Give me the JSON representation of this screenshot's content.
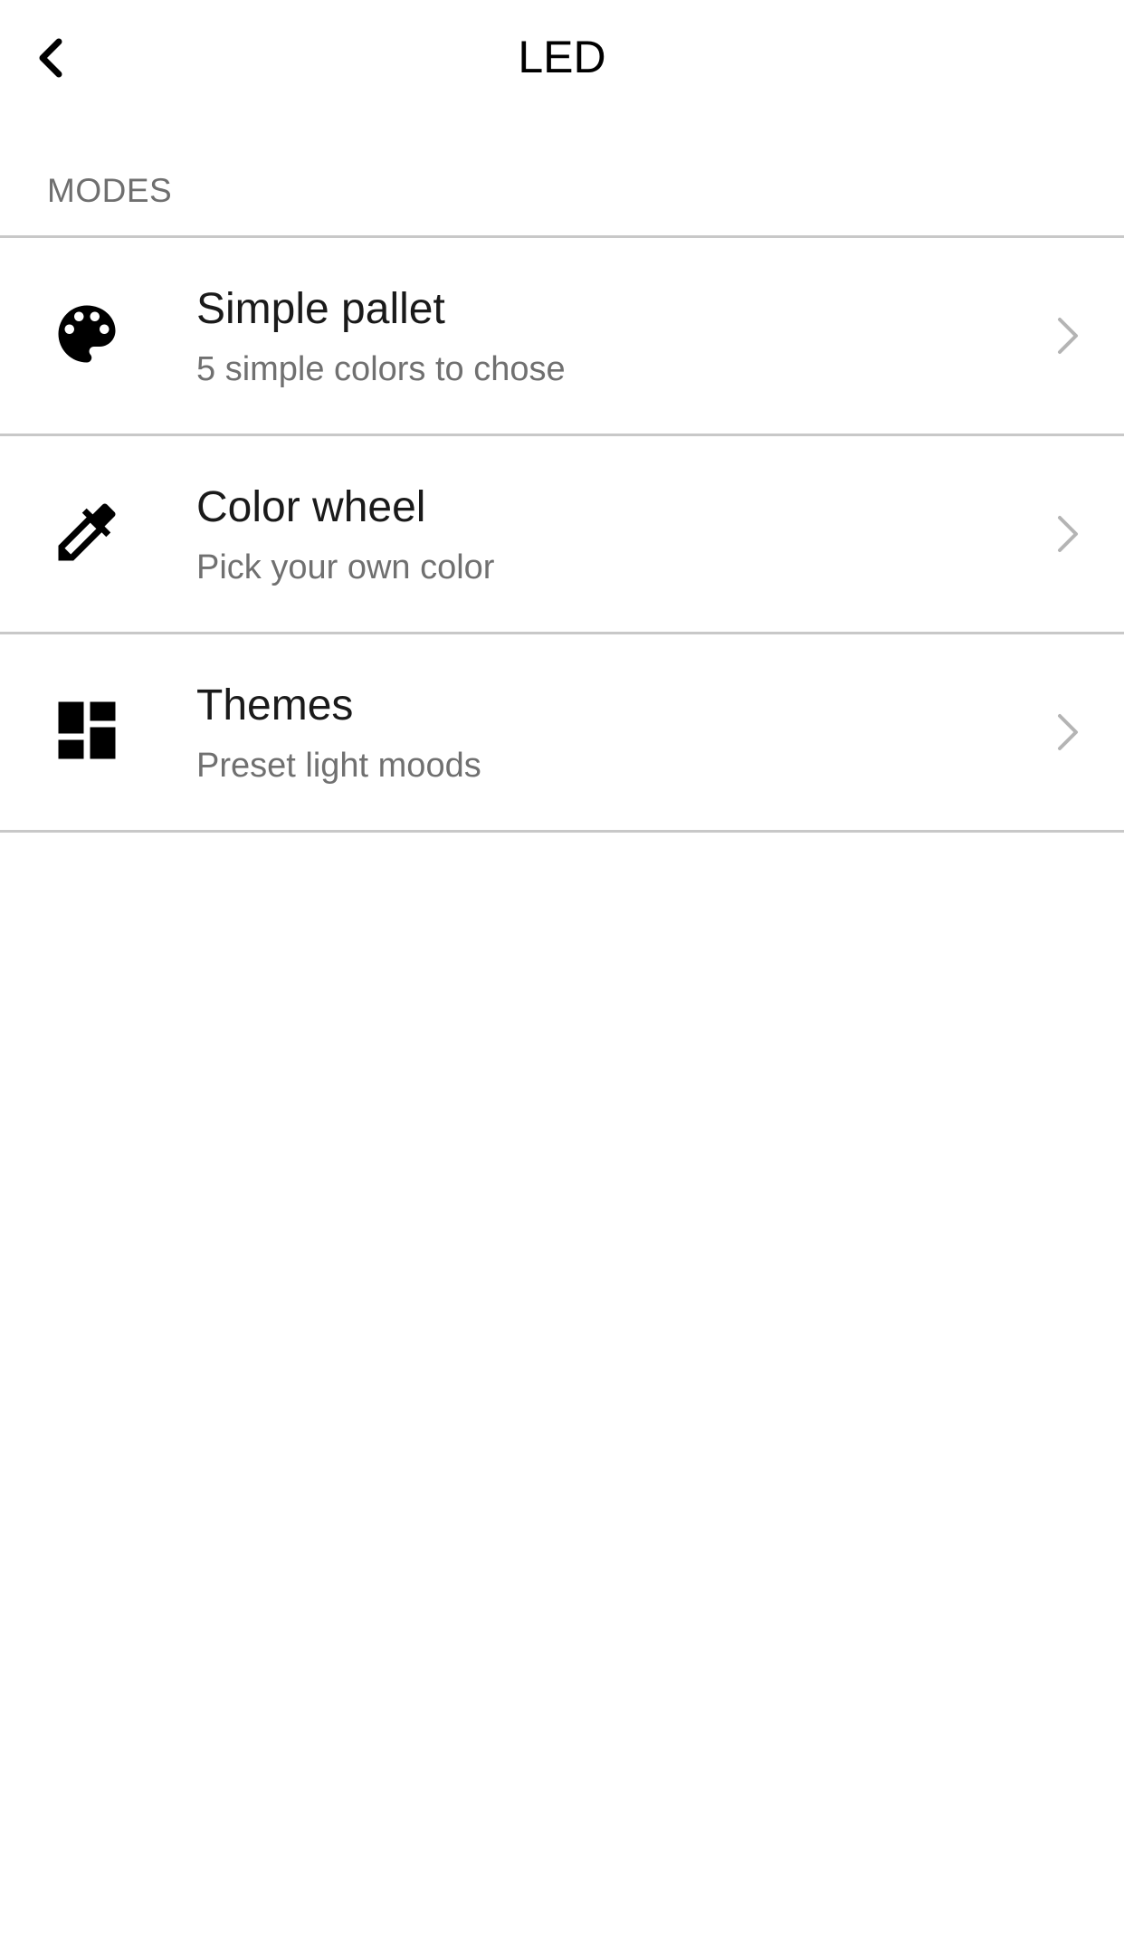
{
  "header": {
    "title": "LED",
    "back_icon": "chevron-left-icon"
  },
  "section": {
    "label": "MODES"
  },
  "modes": [
    {
      "title": "Simple pallet",
      "subtitle": "5 simple colors to chose",
      "icon": "palette-icon"
    },
    {
      "title": "Color wheel",
      "subtitle": "Pick your own color",
      "icon": "eyedropper-icon"
    },
    {
      "title": "Themes",
      "subtitle": "Preset light moods",
      "icon": "dashboard-icon"
    }
  ],
  "colors": {
    "background": "#ffffff",
    "divider": "#c8c8c8",
    "secondary_text": "#707070",
    "chevron": "#b4b4b4"
  }
}
